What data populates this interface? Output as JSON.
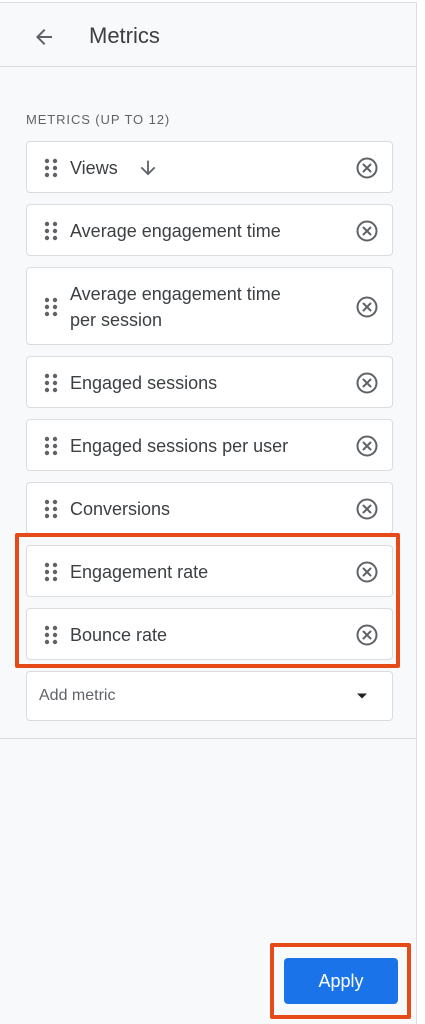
{
  "header": {
    "back_icon": "arrow-left-icon",
    "title": "Metrics"
  },
  "section": {
    "label": "METRICS (UP TO 12)"
  },
  "metrics": [
    {
      "label": "Views",
      "sorted": "descending",
      "sort_icon": "arrow-down-icon"
    },
    {
      "label": "Average engagement time"
    },
    {
      "label_line1": "Average engagement time",
      "label_line2": "per session"
    },
    {
      "label": "Engaged sessions"
    },
    {
      "label": "Engaged sessions per user"
    },
    {
      "label": "Conversions"
    },
    {
      "label": "Engagement rate"
    },
    {
      "label": "Bounce rate"
    }
  ],
  "add_metric": {
    "placeholder": "Add metric",
    "icon": "dropdown-arrow-icon"
  },
  "footer": {
    "apply_label": "Apply"
  },
  "colors": {
    "accent": "#1a73e8",
    "highlight": "#e64a19",
    "text": "#3c4043",
    "secondary_text": "#5f6368"
  }
}
